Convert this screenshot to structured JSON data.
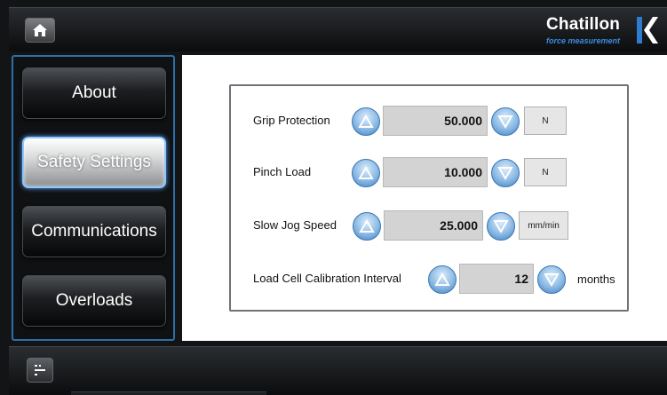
{
  "header": {
    "home_icon": "home-icon",
    "brand_name": "Chatillon",
    "brand_sub": "force measurement"
  },
  "sidebar": {
    "items": [
      {
        "label": "About",
        "active": false
      },
      {
        "label": "Safety Settings",
        "active": true
      },
      {
        "label": "Communications",
        "active": false
      },
      {
        "label": "Overloads",
        "active": false
      }
    ]
  },
  "settings": {
    "grip_protection": {
      "label": "Grip Protection",
      "value": "50.000",
      "unit": "N"
    },
    "pinch_load": {
      "label": "Pinch Load",
      "value": "10.000",
      "unit": "N"
    },
    "slow_jog_speed": {
      "label": "Slow Jog Speed",
      "value": "25.000",
      "unit": "mm/min"
    },
    "calibration_interval": {
      "label": "Load Cell Calibration Interval",
      "value": "12",
      "unit": "months"
    }
  },
  "footer": {
    "menu_icon": "list-menu-icon"
  },
  "colors": {
    "accent_blue": "#2e6fa7",
    "arrow_blue": "#6aa6dc",
    "value_bg": "#d3d3d3"
  }
}
